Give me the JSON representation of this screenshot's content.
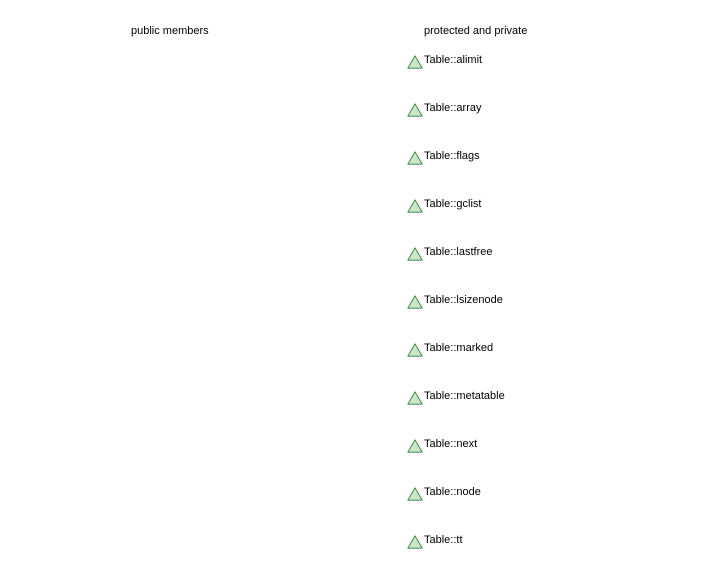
{
  "columns": {
    "public": {
      "title": "public members",
      "items": []
    },
    "protected": {
      "title": "protected and private",
      "marker_icon": "green-triangle-icon",
      "marker_fill": "#c8e6c9",
      "marker_stroke": "#3a7a3a",
      "items": [
        "Table::alimit",
        "Table::array",
        "Table::flags",
        "Table::gclist",
        "Table::lastfree",
        "Table::lsizenode",
        "Table::marked",
        "Table::metatable",
        "Table::next",
        "Table::node",
        "Table::tt"
      ]
    }
  }
}
